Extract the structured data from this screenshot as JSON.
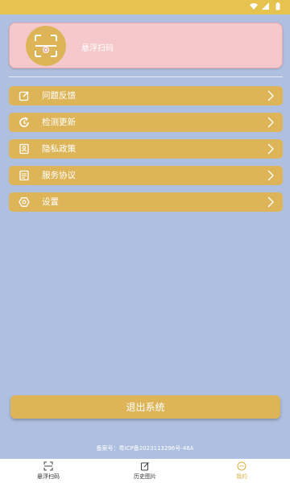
{
  "colors": {
    "background": "#aebfdf",
    "accent": "#ddb558",
    "status_bar": "#e6c24f",
    "header_card": "#f5c9cc"
  },
  "status_bar": {
    "icons": [
      "wifi-icon",
      "signal-icon",
      "battery-icon"
    ]
  },
  "header": {
    "avatar_icon": "scan-frame-icon",
    "title": "悬浮扫码"
  },
  "menu": {
    "items": [
      {
        "label": "问题反馈",
        "icon": "edit-icon"
      },
      {
        "label": "检测更新",
        "icon": "update-icon"
      },
      {
        "label": "隐私政策",
        "icon": "privacy-icon"
      },
      {
        "label": "服务协议",
        "icon": "agreement-icon"
      },
      {
        "label": "设置",
        "icon": "settings-icon"
      }
    ]
  },
  "logout_label": "退出系统",
  "icp": "备案号：粤ICP备2023113296号-46A",
  "bottom_nav": {
    "items": [
      {
        "label": "悬浮扫码",
        "icon": "scan-icon",
        "active": false
      },
      {
        "label": "历史图片",
        "icon": "history-image-icon",
        "active": false
      },
      {
        "label": "我的",
        "icon": "profile-icon",
        "active": true
      }
    ]
  }
}
